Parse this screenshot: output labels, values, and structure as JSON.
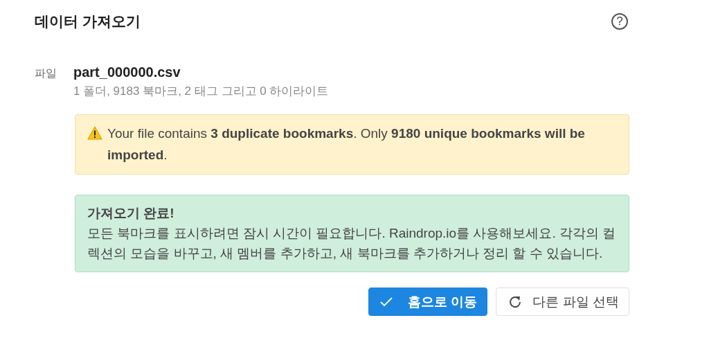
{
  "header": {
    "title": "데이터 가져오기",
    "help": "?"
  },
  "file": {
    "label": "파일",
    "name": "part_000000.csv",
    "summary": "1 폴더, 9183 북마크, 2 태그 그리고 0 하이라이트"
  },
  "alerts": [
    {
      "kind": "warning",
      "text": "Your file contains **3 duplicate bookmarks**. Only **9180 unique bookmarks will be imported**."
    },
    {
      "kind": "success",
      "title": "가져오기 완료!",
      "text": "모든 북마크를 표시하려면 잠시 시간이 필요합니다. Raindrop.io를 사용해보세요. 각각의 컬렉션의 모습을 바꾸고, 새 멤버를 추가하고, 새 북마크를 추가하거나 정리 할 수 있습니다."
    }
  ],
  "buttons": [
    {
      "kind": "primary",
      "label": "홈으로 이동"
    },
    {
      "kind": "secondary",
      "label": "다른 파일 선택"
    }
  ]
}
